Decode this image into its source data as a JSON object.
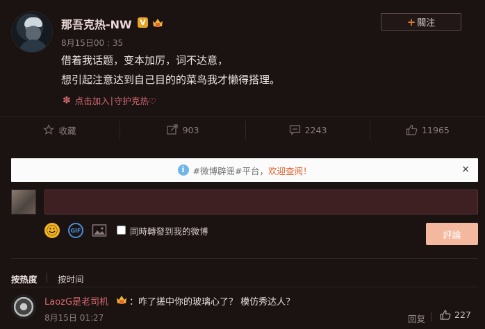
{
  "post": {
    "username": "那吾克热-NW",
    "v_badge": "V",
    "follow_label": "關注",
    "follow_plus": "+",
    "timestamp": "8月15日00 : 35",
    "lines": [
      "借着我话题，变本加厉，词不达意，",
      "想引起注意达到自己目的的菜鸟我才懒得搭理。"
    ],
    "topic_prefix": "点击加入",
    "topic_sep": "|",
    "topic_name": "守护克热♡"
  },
  "actions": {
    "favorite_label": "收藏",
    "repost_count": "903",
    "comment_count": "2243",
    "like_count": "11965"
  },
  "notice": {
    "info_glyph": "i",
    "text": "#微博辟谣#平台，",
    "welcome": "欢迎查阅！",
    "close": "×"
  },
  "composer": {
    "repost_label": "同時轉發到我的微博",
    "submit_label": "評論",
    "gif_label": "GIF"
  },
  "sort": {
    "hot": "按热度",
    "time": "按时间"
  },
  "comment": {
    "author": "LaozG是老司机",
    "text": "：咋了搓中你的玻璃心了？ 模仿秀达人？",
    "time": "8月15日 01:27",
    "reply_label": "回复",
    "like_count": "227"
  },
  "colors": {
    "background": "#1b1212",
    "accent_orange": "#e07b2a",
    "link_red": "#d0686c",
    "submit_bg": "#f3b89d"
  }
}
